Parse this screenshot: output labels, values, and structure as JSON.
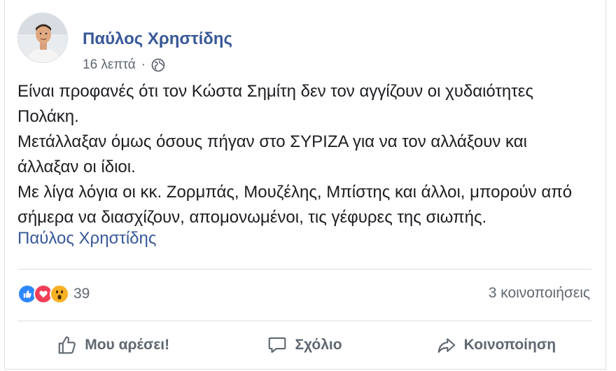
{
  "post": {
    "author": "Παύλος Χρηστίδης",
    "time": "16 λεπτά",
    "separator": "·",
    "privacy_icon": "globe-icon",
    "paragraphs": [
      "Είναι προφανές ότι τον Κώστα Σημίτη δεν τον αγγίζουν οι χυδαιότητες Πολάκη.",
      "Μετάλλαξαν όμως όσους πήγαν στο ΣΥΡΙΖΑ για να τον αλλάξουν και άλλαξαν οι ίδιοι.",
      "Με λίγα λόγια οι κκ. Ζορμπάς, Μουζέλης, Μπίστης και άλλοι, μπορούν από σήμερα να διασχίζουν, απομονωμένοι, τις γέφυρες της σιωπής."
    ],
    "signature": "Παύλος Χρηστίδης"
  },
  "stats": {
    "reaction_icons": [
      "like-icon",
      "love-icon",
      "wow-icon"
    ],
    "reaction_count": "39",
    "shares": "3 κοινοποιήσεις"
  },
  "actions": {
    "like": "Μου αρέσει!",
    "comment": "Σχόλιο",
    "share": "Κοινοποίηση"
  },
  "colors": {
    "link": "#385898",
    "text": "#1c1e21",
    "secondary": "#606770",
    "like": "#2d88ff",
    "love": "#f33e58",
    "wow": "#f7b125"
  }
}
